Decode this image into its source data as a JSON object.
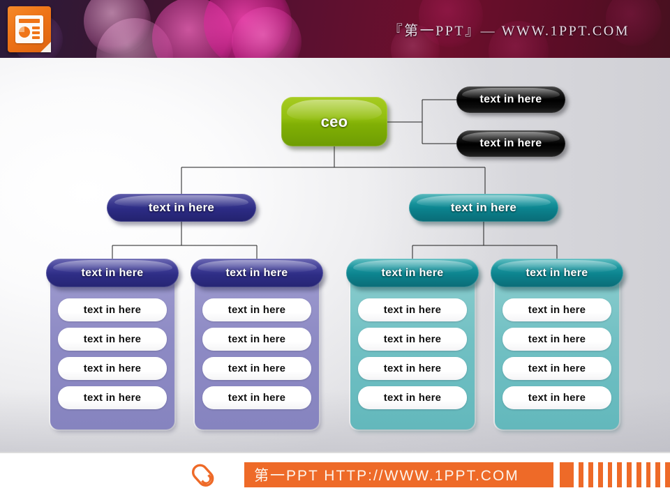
{
  "header": {
    "logo_icon": "powerpoint-file-icon",
    "brand_text": "『第一PPT』— WWW.1PPT.COM"
  },
  "chart": {
    "title": "organization-chart",
    "root": {
      "label": "ceo",
      "color": "#93bf10"
    },
    "staff": [
      {
        "label": "text in here",
        "color": "#000000"
      },
      {
        "label": "text in here",
        "color": "#000000"
      }
    ],
    "branches": [
      {
        "label": "text in here",
        "color": "#2c2b84",
        "columns": [
          {
            "header": "text in here",
            "header_color": "#2e2d86",
            "panel_color": "#8d8ac4",
            "items": [
              "text in here",
              "text in here",
              "text in here",
              "text in here"
            ]
          },
          {
            "header": "text in here",
            "header_color": "#2e2d86",
            "panel_color": "#8d8ac4",
            "items": [
              "text in here",
              "text in here",
              "text in here",
              "text in here"
            ]
          }
        ]
      },
      {
        "label": "text in here",
        "color": "#0b828d",
        "columns": [
          {
            "header": "text in here",
            "header_color": "#0c838e",
            "panel_color": "#71c0c3",
            "items": [
              "text in here",
              "text in here",
              "text in here",
              "text in here"
            ]
          },
          {
            "header": "text in here",
            "header_color": "#0c838e",
            "panel_color": "#71c0c3",
            "items": [
              "text in here",
              "text in here",
              "text in here",
              "text in here"
            ]
          }
        ]
      }
    ]
  },
  "footer": {
    "pen_icon": "pen-icon",
    "text": "第一PPT HTTP://WWW.1PPT.COM",
    "accent_color": "#ee6a28"
  }
}
